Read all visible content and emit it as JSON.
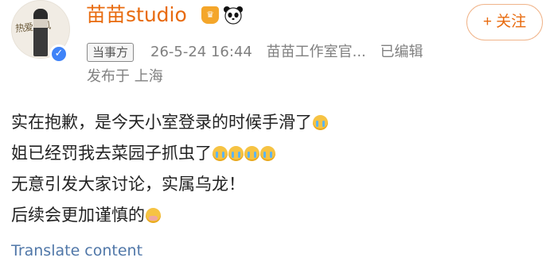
{
  "post": {
    "user": {
      "name": "苗苗studio",
      "avatar_text": "热爱成风",
      "verified_icon": "verified-check-icon",
      "level_icon": "crown-badge-icon",
      "special_icon": "panda-icon"
    },
    "follow_button": "+ 关注",
    "tag": "当事方",
    "meta": {
      "date": "26-5-24 16:44",
      "source": "苗苗工作室官...",
      "edited": "已编辑"
    },
    "location": "发布于 上海",
    "content_lines": [
      {
        "text": "实在抱歉，是今天小室登录的时候手滑了",
        "emoji": "cry-emoji",
        "emoji_count": 1
      },
      {
        "text": "姐已经罚我去菜园子抓虫了",
        "emoji": "cry-emoji",
        "emoji_count": 4
      },
      {
        "text": "无意引发大家讨论，实属乌龙！",
        "emoji": "",
        "emoji_count": 0
      },
      {
        "text": "后续会更加谨慎的",
        "emoji": "shy-emoji",
        "emoji_count": 1
      }
    ],
    "translate_link": "Translate content"
  },
  "colors": {
    "username": "#e86b0f",
    "follow_border": "#f0b48a",
    "meta_gray": "#808080",
    "link_blue": "#5077a8",
    "verified_blue": "#3f83f8"
  }
}
